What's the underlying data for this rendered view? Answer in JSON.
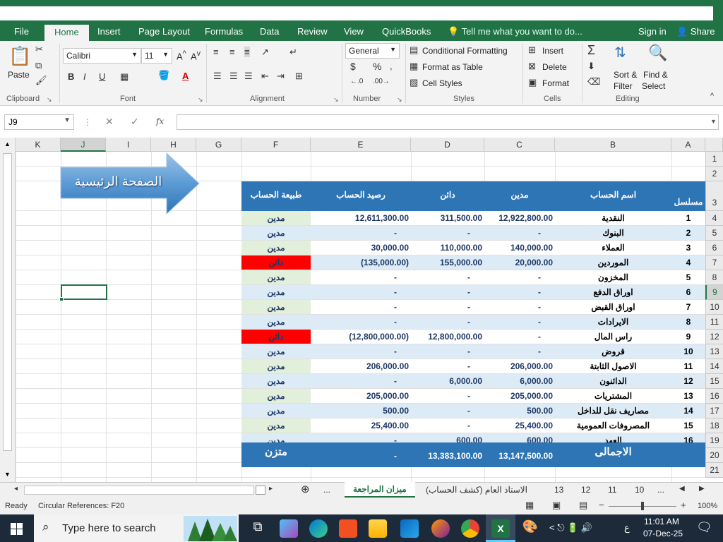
{
  "ribbon_tabs": [
    "File",
    "Home",
    "Insert",
    "Page Layout",
    "Formulas",
    "Data",
    "Review",
    "View",
    "QuickBooks"
  ],
  "tell_me": "Tell me what you want to do...",
  "sign_in": "Sign in",
  "share": "Share",
  "clipboard": {
    "paste": "Paste",
    "label": "Clipboard"
  },
  "font": {
    "name": "Calibri",
    "size": "11",
    "label": "Font",
    "bold": "B",
    "italic": "I",
    "underline": "U"
  },
  "alignment": {
    "label": "Alignment"
  },
  "number": {
    "format": "General",
    "label": "Number",
    "currency": "$",
    "percent": "%"
  },
  "styles": {
    "conditional": "Conditional Formatting",
    "table": "Format as Table",
    "cell": "Cell Styles",
    "label": "Styles"
  },
  "cells": {
    "insert": "Insert",
    "delete": "Delete",
    "format": "Format",
    "label": "Cells"
  },
  "editing": {
    "sort": "Sort &",
    "filter": "Filter",
    "find": "Find &",
    "select": "Select",
    "label": "Editing"
  },
  "name_box": "J9",
  "fx": "fx",
  "columns": [
    "A",
    "B",
    "C",
    "D",
    "E",
    "F",
    "G",
    "H",
    "I",
    "J",
    "K"
  ],
  "rows": [
    "1",
    "2",
    "3",
    "4",
    "5",
    "6",
    "7",
    "8",
    "9",
    "10",
    "11",
    "12",
    "13",
    "14",
    "15",
    "16",
    "17",
    "18",
    "19",
    "20",
    "21"
  ],
  "home_button": "الصفحة الرئيسية",
  "table": {
    "headers": [
      "مسلسل",
      "اسم الحساب",
      "مدين",
      "دائن",
      "رصيد الحساب",
      "طبيعة الحساب"
    ],
    "rows": [
      {
        "n": "1",
        "name": "النقدية",
        "debit": "12,922,800.00",
        "credit": "311,500.00",
        "balance": "12,611,300.00",
        "nature": "مدين"
      },
      {
        "n": "2",
        "name": "البنوك",
        "debit": "-",
        "credit": "-",
        "balance": "-",
        "nature": "مدين"
      },
      {
        "n": "3",
        "name": "العملاء",
        "debit": "140,000.00",
        "credit": "110,000.00",
        "balance": "30,000.00",
        "nature": "مدين"
      },
      {
        "n": "4",
        "name": "الموردين",
        "debit": "20,000.00",
        "credit": "155,000.00",
        "balance": "(135,000.00)",
        "nature": "دائن"
      },
      {
        "n": "5",
        "name": "المخزون",
        "debit": "-",
        "credit": "-",
        "balance": "-",
        "nature": "مدين"
      },
      {
        "n": "6",
        "name": "اوراق الدفع",
        "debit": "-",
        "credit": "-",
        "balance": "-",
        "nature": "مدين"
      },
      {
        "n": "7",
        "name": "اوراق القبض",
        "debit": "-",
        "credit": "-",
        "balance": "-",
        "nature": "مدين"
      },
      {
        "n": "8",
        "name": "الايرادات",
        "debit": "-",
        "credit": "-",
        "balance": "-",
        "nature": "مدين"
      },
      {
        "n": "9",
        "name": "راس المال",
        "debit": "-",
        "credit": "12,800,000.00",
        "balance": "(12,800,000.00)",
        "nature": "دائن"
      },
      {
        "n": "10",
        "name": "قروض",
        "debit": "-",
        "credit": "-",
        "balance": "-",
        "nature": "مدين"
      },
      {
        "n": "11",
        "name": "الاصول الثابتة",
        "debit": "206,000.00",
        "credit": "-",
        "balance": "206,000.00",
        "nature": "مدين"
      },
      {
        "n": "12",
        "name": "الدائنون",
        "debit": "6,000.00",
        "credit": "6,000.00",
        "balance": "-",
        "nature": "مدين"
      },
      {
        "n": "13",
        "name": "المشتريات",
        "debit": "205,000.00",
        "credit": "-",
        "balance": "205,000.00",
        "nature": "مدين"
      },
      {
        "n": "14",
        "name": "مصاريف نقل للداخل",
        "debit": "500.00",
        "credit": "-",
        "balance": "500.00",
        "nature": "مدين"
      },
      {
        "n": "15",
        "name": "المصروفات العمومية",
        "debit": "25,400.00",
        "credit": "-",
        "balance": "25,400.00",
        "nature": "مدين"
      },
      {
        "n": "16",
        "name": "العهد",
        "debit": "600.00",
        "credit": "600.00",
        "balance": "-",
        "nature": "مدين"
      }
    ],
    "total": {
      "label": "الاجمالى",
      "debit": "13,147,500.00",
      "credit": "13,383,100.00",
      "balance": "-",
      "nature": "متزن"
    }
  },
  "sheet_tabs": [
    "...",
    "ميزان المراجعة",
    "الاستاذ العام (كشف الحساب)",
    "13",
    "12",
    "11",
    "10",
    "..."
  ],
  "status": {
    "ready": "Ready",
    "circular": "Circular References: F20",
    "zoom": "100%"
  },
  "taskbar": {
    "search": "Type here to search",
    "time": "11:01 AM",
    "date": "07-Dec-25",
    "lang": "ع"
  },
  "colors": {
    "excel_green": "#217346",
    "header_blue": "#2e75b6",
    "stripe_blue": "#ddebf7",
    "nature_green": "#e2efda",
    "red": "#ff0000",
    "dark_blue": "#1f3864"
  }
}
